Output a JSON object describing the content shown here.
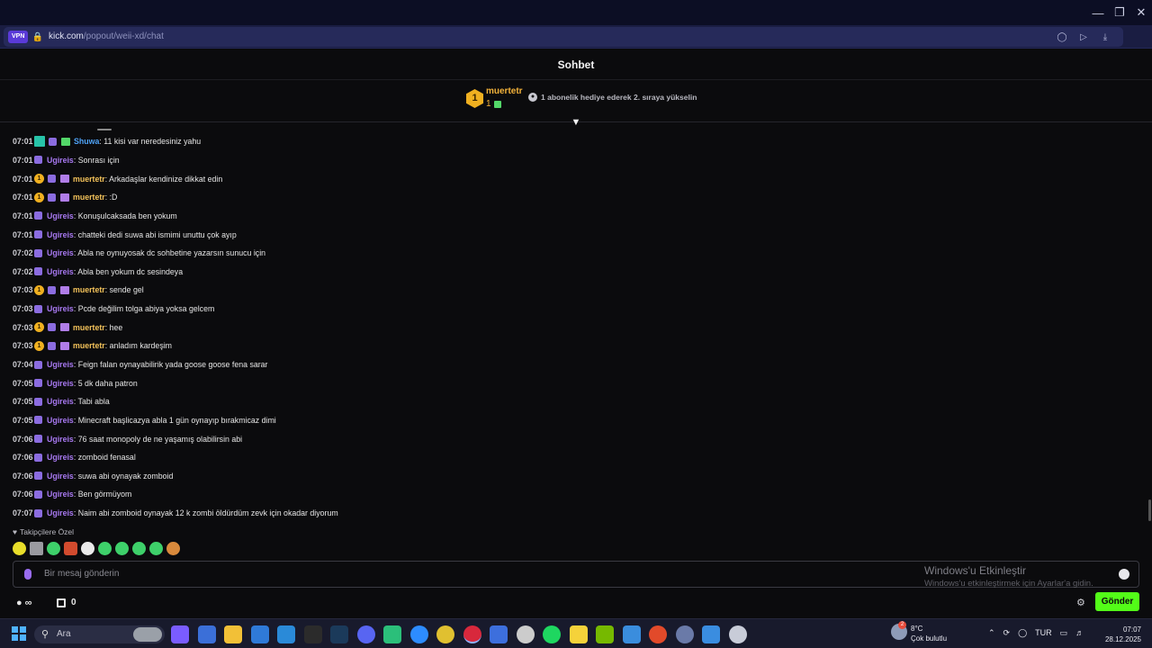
{
  "browser": {
    "vpn_label": "VPN",
    "url_domain": "kick.com",
    "url_path": "/popout/weii-xd/chat"
  },
  "chat": {
    "title": "Sohbet",
    "pinned": {
      "gifter_rank": "1",
      "gifter_name": "muertetr",
      "gifter_count": "1",
      "promo_text": "1 abonelik hediye ederek 2. sıraya yükselin"
    },
    "messages": [
      {
        "time": "07:01",
        "badges": [
          "qr",
          "pawn",
          "gift-green"
        ],
        "user": "Shuwa",
        "user_color": "#4fa3f7",
        "text": ": 11 kisi var neredesiniz yahu"
      },
      {
        "time": "07:01",
        "badges": [
          "pawn"
        ],
        "user": "Ugireis",
        "user_color": "#a879f2",
        "text": ": Sonrası için"
      },
      {
        "time": "07:01",
        "badges": [
          "rank1",
          "pawn",
          "gift-purple"
        ],
        "user": "muertetr",
        "user_color": "#f3c25a",
        "text": ": Arkadaşlar kendinize dikkat edin"
      },
      {
        "time": "07:01",
        "badges": [
          "rank1",
          "pawn",
          "gift-purple"
        ],
        "user": "muertetr",
        "user_color": "#f3c25a",
        "text": ": :D"
      },
      {
        "time": "07:01",
        "badges": [
          "pawn"
        ],
        "user": "Ugireis",
        "user_color": "#a879f2",
        "text": ": Konuşulcaksada ben yokum"
      },
      {
        "time": "07:01",
        "badges": [
          "pawn"
        ],
        "user": "Ugireis",
        "user_color": "#a879f2",
        "text": ": chatteki dedi suwa abi ismimi unuttu çok ayıp"
      },
      {
        "time": "07:02",
        "badges": [
          "pawn"
        ],
        "user": "Ugireis",
        "user_color": "#a879f2",
        "text": ": Abla ne oynuyosak dc sohbetine yazarsın sunucu için"
      },
      {
        "time": "07:02",
        "badges": [
          "pawn"
        ],
        "user": "Ugireis",
        "user_color": "#a879f2",
        "text": ": Abla ben yokum dc sesindeya"
      },
      {
        "time": "07:03",
        "badges": [
          "rank1",
          "pawn",
          "gift-purple"
        ],
        "user": "muertetr",
        "user_color": "#f3c25a",
        "text": ": sende gel"
      },
      {
        "time": "07:03",
        "badges": [
          "pawn"
        ],
        "user": "Ugireis",
        "user_color": "#a879f2",
        "text": ": Pcde değilim tolga abiya yoksa gelcem"
      },
      {
        "time": "07:03",
        "badges": [
          "rank1",
          "pawn",
          "gift-purple"
        ],
        "user": "muertetr",
        "user_color": "#f3c25a",
        "text": ": hee"
      },
      {
        "time": "07:03",
        "badges": [
          "rank1",
          "pawn",
          "gift-purple"
        ],
        "user": "muertetr",
        "user_color": "#f3c25a",
        "text": ": anladım kardeşim"
      },
      {
        "time": "07:04",
        "badges": [
          "pawn"
        ],
        "user": "Ugireis",
        "user_color": "#a879f2",
        "text": ": Feign falan oynayabilirik yada goose goose fena sarar"
      },
      {
        "time": "07:05",
        "badges": [
          "pawn"
        ],
        "user": "Ugireis",
        "user_color": "#a879f2",
        "text": ": 5 dk daha patron"
      },
      {
        "time": "07:05",
        "badges": [
          "pawn"
        ],
        "user": "Ugireis",
        "user_color": "#a879f2",
        "text": ": Tabi abla"
      },
      {
        "time": "07:05",
        "badges": [
          "pawn"
        ],
        "user": "Ugireis",
        "user_color": "#a879f2",
        "text": ": Minecraft başlicazya abla 1 gün oynayıp bırakmicaz dimi"
      },
      {
        "time": "07:06",
        "badges": [
          "pawn"
        ],
        "user": "Ugireis",
        "user_color": "#a879f2",
        "text": ": 76 saat monopoly de ne yaşamış olabilirsin abi"
      },
      {
        "time": "07:06",
        "badges": [
          "pawn"
        ],
        "user": "Ugireis",
        "user_color": "#a879f2",
        "text": ": zomboid fenasal"
      },
      {
        "time": "07:06",
        "badges": [
          "pawn"
        ],
        "user": "Ugireis",
        "user_color": "#a879f2",
        "text": ": suwa abi oynayak zomboid"
      },
      {
        "time": "07:06",
        "badges": [
          "pawn"
        ],
        "user": "Ugireis",
        "user_color": "#a879f2",
        "text": ": Ben görmüyom"
      },
      {
        "time": "07:07",
        "badges": [
          "pawn"
        ],
        "user": "Ugireis",
        "user_color": "#a879f2",
        "text": ": Naim abi zomboid oynayak 12 k zombi öldürdüm zevk için okadar diyorum"
      }
    ],
    "followers_only_label": "Takipçilere Özel",
    "emote_count_note": "",
    "input_placeholder": "Bir mesaj gönderin",
    "points_symbol": "∞",
    "gift_count": "0",
    "send_label": "Gönder"
  },
  "watermark": {
    "title": "Windows'u Etkinleştir",
    "subtitle": "Windows'u etkinleştirmek için Ayarlar'a gidin."
  },
  "taskbar": {
    "search_label": "Ara",
    "weather_badge": "2",
    "temperature": "8°C",
    "weather_desc": "Çok bulutlu",
    "language": "TUR",
    "time": "07:07",
    "date": "28.12.2025"
  },
  "colors": {
    "accent_green": "#53fc18",
    "gifter_gold": "#f0b020",
    "user_purple": "#a879f2",
    "user_gold": "#f3c25a",
    "user_blue": "#4fa3f7"
  }
}
